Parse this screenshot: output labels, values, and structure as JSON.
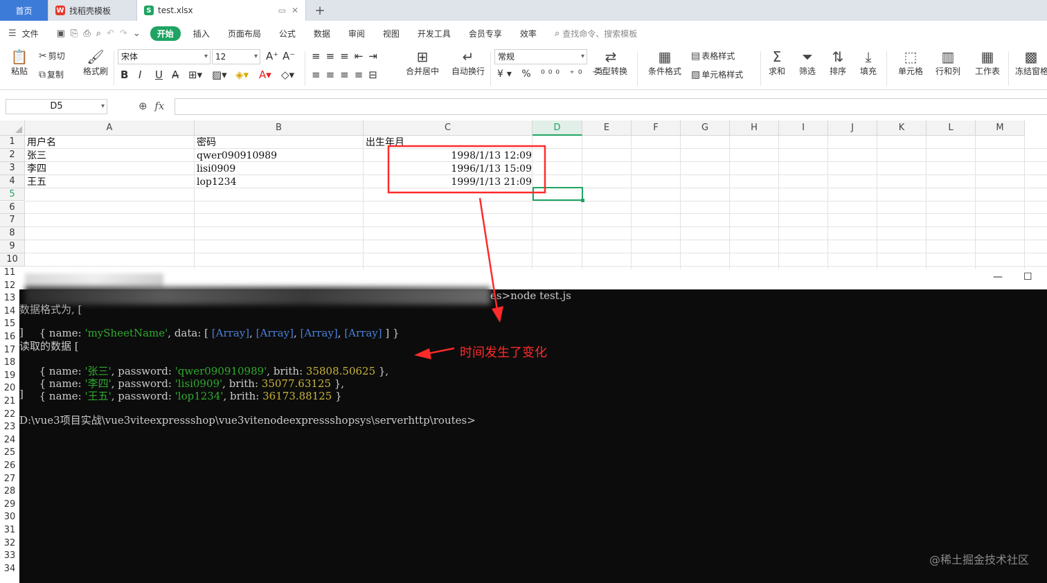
{
  "tabs": {
    "home": "首页",
    "template": "找稻壳模板",
    "file": "test.xlsx",
    "new_tab": "+"
  },
  "menu": {
    "file": "文件",
    "items": [
      "开始",
      "插入",
      "页面布局",
      "公式",
      "数据",
      "审阅",
      "视图",
      "开发工具",
      "会员专享",
      "效率"
    ],
    "search": "查找命令、搜索模板"
  },
  "ribbon": {
    "paste": "粘贴",
    "cut": "剪切",
    "copy": "复制",
    "format_painter": "格式刷",
    "font_name": "宋体",
    "font_size": "12",
    "merge_center": "合并居中",
    "wrap_text": "自动换行",
    "number_format": "常规",
    "type_convert": "类型转换",
    "cond_format": "条件格式",
    "table_style": "表格样式",
    "cell_style": "单元格样式",
    "sum": "求和",
    "filter": "筛选",
    "sort": "排序",
    "fill": "填充",
    "cell": "单元格",
    "row_col": "行和列",
    "worksheet": "工作表",
    "freeze": "冻结窗格"
  },
  "formula": {
    "name_box": "D5",
    "fx": "fx"
  },
  "grid": {
    "columns": [
      "A",
      "B",
      "C",
      "D",
      "E",
      "F",
      "G",
      "H",
      "I",
      "J",
      "K",
      "L",
      "M"
    ],
    "rows": [
      "1",
      "2",
      "3",
      "4",
      "5",
      "6",
      "7",
      "8",
      "9",
      "10"
    ],
    "header": [
      "用户名",
      "密码",
      "出生年月"
    ],
    "data": [
      [
        "张三",
        "qwer090910989",
        "1998/1/13  12:09"
      ],
      [
        "李四",
        "lisi0909",
        "1996/1/13  15:09"
      ],
      [
        "王五",
        "lop1234",
        "1999/1/13  21:09"
      ]
    ]
  },
  "lower_rows": [
    "11",
    "12",
    "13",
    "14",
    "15",
    "16",
    "17",
    "18",
    "19",
    "20",
    "21",
    "22",
    "23",
    "24",
    "25",
    "26",
    "27",
    "28",
    "29",
    "30",
    "31",
    "32",
    "33",
    "34"
  ],
  "terminal": {
    "minimize": "—",
    "maximize": "☐",
    "cmd": "es>node test.js",
    "line_write_prefix": "数据格式为, [",
    "line_sheet": "  { name: 'mySheetName', data: [ [Array], [Array], [Array], [Array] ] }",
    "line_close1": "]",
    "line_read": "读取的数据 [",
    "rows": [
      {
        "name": "'张三'",
        "password": "'qwer090910989'",
        "brith": "35808.50625",
        "tail": " },"
      },
      {
        "name": "'李四'",
        "password": "'lisi0909'",
        "brith": "35077.63125",
        "tail": " },"
      },
      {
        "name": "'王五'",
        "password": "'lop1234'",
        "brith": "36173.88125",
        "tail": " }"
      }
    ],
    "line_close2": "]",
    "prompt": "D:\\vue3项目实战\\vue3viteexpressshop\\vue3vitenodeexpressshopsys\\serverhttp\\routes>"
  },
  "annotation": "时间发生了变化",
  "watermark": "@稀土掘金技术社区",
  "colors": {
    "accent_green": "#1fa463",
    "annotation_red": "#ff2a2a",
    "home_tab": "#3d7bd9"
  }
}
